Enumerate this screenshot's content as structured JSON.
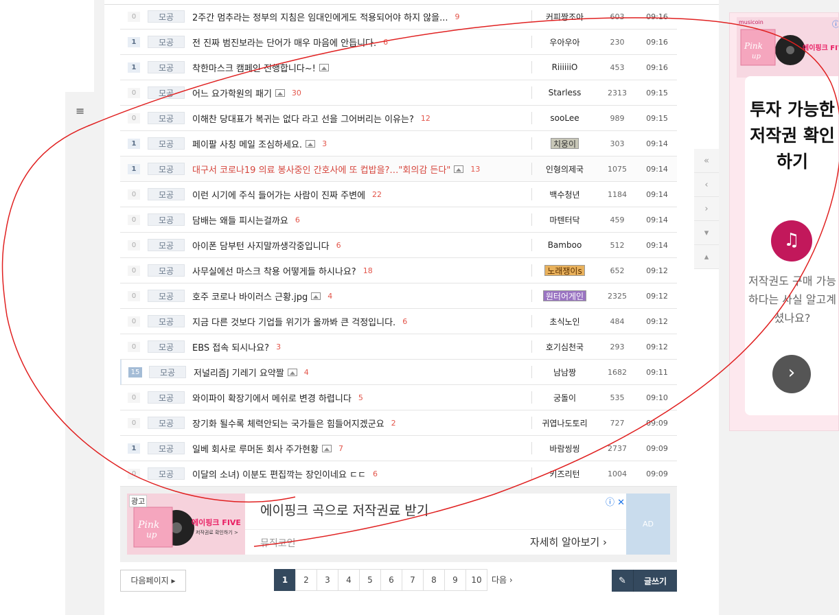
{
  "rows": [
    {
      "cnt": "0",
      "cat": "모공",
      "title": "2주간 멈추라는 정부의 지침은 임대인에게도 적용되어야 하지 않을...",
      "img": false,
      "reply": "9",
      "nick": "커피짱조아",
      "views": "603",
      "time": "09:16"
    },
    {
      "cnt": "1",
      "cat": "모공",
      "title": "전 진짜 범진보라는 단어가 매우 마음에 안듭니다.",
      "img": false,
      "reply": "6",
      "nick": "우아우아",
      "views": "230",
      "time": "09:16"
    },
    {
      "cnt": "1",
      "cat": "모공",
      "title": "착한마스크 캠페인 진행합니다~!",
      "img": true,
      "reply": "",
      "nick": "RiiiiiiO",
      "views": "453",
      "time": "09:16"
    },
    {
      "cnt": "0",
      "cat": "모공",
      "title": "어느 요가학원의 패기",
      "img": true,
      "reply": "30",
      "nick": "Starless",
      "views": "2313",
      "time": "09:15"
    },
    {
      "cnt": "0",
      "cat": "모공",
      "title": "이해찬 당대표가 복귀는 없다 라고 선을 그어버리는 이유는?",
      "img": false,
      "reply": "12",
      "nick": "sooLee",
      "views": "989",
      "time": "09:15"
    },
    {
      "cnt": "1",
      "cat": "모공",
      "title": "페이팔 사칭 메일 조심하세요.",
      "img": true,
      "reply": "3",
      "nick": "치웅이",
      "views": "303",
      "time": "09:14"
    },
    {
      "cnt": "1",
      "cat": "모공",
      "title": "대구서 코로나19 의료 봉사중인 간호사에 또 컵밥을?…\"회의감 든다\"",
      "img": true,
      "reply": "13",
      "nick": "인형의제국",
      "views": "1075",
      "time": "09:14"
    },
    {
      "cnt": "0",
      "cat": "모공",
      "title": "이런 시기에 주식 들어가는 사람이 진짜 주변에",
      "img": false,
      "reply": "22",
      "nick": "백수청년",
      "views": "1184",
      "time": "09:14"
    },
    {
      "cnt": "0",
      "cat": "모공",
      "title": "담배는 왜들 피시는걸까요",
      "img": false,
      "reply": "6",
      "nick": "마텐터닥",
      "views": "459",
      "time": "09:14"
    },
    {
      "cnt": "0",
      "cat": "모공",
      "title": "아이폰 담부턴 사지말까생각중입니다",
      "img": false,
      "reply": "6",
      "nick": "Bamboo",
      "views": "512",
      "time": "09:14"
    },
    {
      "cnt": "0",
      "cat": "모공",
      "title": "사무실에선 마스크 착용 어떻게들 하시나요?",
      "img": false,
      "reply": "18",
      "nick": "노래쟁이s",
      "views": "652",
      "time": "09:12"
    },
    {
      "cnt": "0",
      "cat": "모공",
      "title": "호주 코로나 바이러스 근황.jpg",
      "img": true,
      "reply": "4",
      "nick": "원터어게인",
      "views": "2325",
      "time": "09:12"
    },
    {
      "cnt": "0",
      "cat": "모공",
      "title": "지금 다른 것보다 기업들 위기가 올까봐 큰 걱정입니다.",
      "img": false,
      "reply": "6",
      "nick": "초식노인",
      "views": "484",
      "time": "09:12"
    },
    {
      "cnt": "0",
      "cat": "모공",
      "title": "EBS 접속 되시나요?",
      "img": false,
      "reply": "3",
      "nick": "호기심천국",
      "views": "293",
      "time": "09:12"
    },
    {
      "cnt": "15",
      "cat": "모공",
      "title": "저널리즘J 기레기 요약짤",
      "img": true,
      "reply": "4",
      "nick": "남남짱",
      "views": "1682",
      "time": "09:11"
    },
    {
      "cnt": "0",
      "cat": "모공",
      "title": "와이파이 확장기에서 메쉬로 변경 하렵니다",
      "img": false,
      "reply": "5",
      "nick": "궁돌이",
      "views": "535",
      "time": "09:10"
    },
    {
      "cnt": "0",
      "cat": "모공",
      "title": "장기화 될수록 체력안되는 국가들은 힘들어지겠군요",
      "img": false,
      "reply": "2",
      "nick": "귀엽나도토리",
      "views": "727",
      "time": "09:09"
    },
    {
      "cnt": "1",
      "cat": "모공",
      "title": "일베 회사로 루머돈 회사 주가현황",
      "img": true,
      "reply": "7",
      "nick": "바람씽씽",
      "views": "2737",
      "time": "09:09"
    },
    {
      "cnt": "0",
      "cat": "모공",
      "title": "이달의 소녀) 이분도 편집깍는 장인이네요 ㄷㄷ",
      "img": false,
      "reply": "6",
      "nick": "키즈리턴",
      "views": "1004",
      "time": "09:09"
    }
  ],
  "ad": {
    "label": "광고",
    "thumb_text": "에이핑크 FIVE",
    "thumb_sub": "저작권료 확인하기 >",
    "headline": "에이핑크 곡으로 저작권료 받기",
    "source": "뮤직코인",
    "more": "자세히 알아보기",
    "box": "AD"
  },
  "pagination": {
    "next_page": "다음페이지",
    "pages": [
      "1",
      "2",
      "3",
      "4",
      "5",
      "6",
      "7",
      "8",
      "9",
      "10"
    ],
    "next": "다음",
    "write": "글쓰기"
  },
  "right_ad": {
    "brand": "musicoin",
    "thumb_text": "에이핑크 FIVE",
    "headline": "투자 가능한 저작권 확인하기",
    "body": "저작권도 구매 가능하다는 사실 알고계셨나요?",
    "go": "›"
  },
  "side_nav": [
    "«",
    "‹",
    "›",
    "▾",
    "▴"
  ],
  "menu_icon": "≡",
  "colors": {
    "pager_active": "#34495e",
    "reply": "#e3554a",
    "highlight_title": "#d6463d",
    "annotation": "#e02020"
  }
}
